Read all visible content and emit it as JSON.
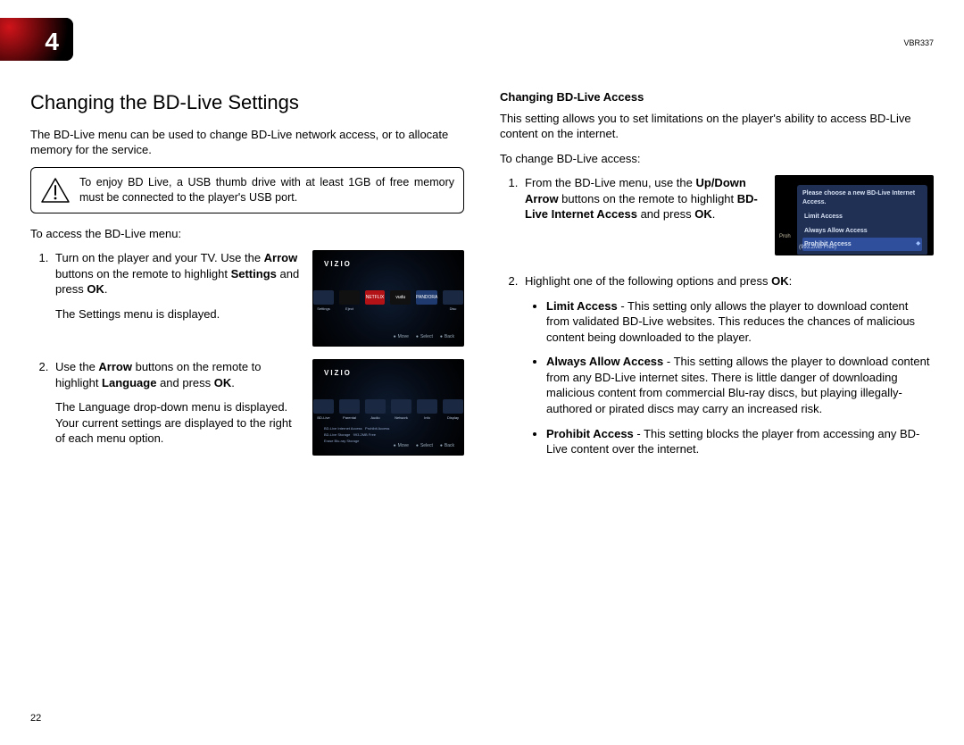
{
  "meta": {
    "model": "VBR337",
    "page_number": "22",
    "chapter": "4"
  },
  "left": {
    "heading": "Changing the BD-Live Settings",
    "intro": "The BD-Live menu can be used to change BD-Live network access, or to allocate memory for the service.",
    "callout": "To enjoy BD Live, a USB thumb drive with at least 1GB of free memory must be connected to the player's USB port.",
    "access_lead": "To access the BD-Live menu:",
    "step1a": "Turn on the player and your TV. Use the ",
    "step1b": "Arrow",
    "step1c": " buttons on the remote to highlight ",
    "step1d": "Settings",
    "step1e": " and press ",
    "step1f": "OK",
    "step1g": ".",
    "step1h": "The Settings menu is displayed.",
    "step2a": "Use the ",
    "step2b": "Arrow",
    "step2c": " buttons on the remote to highlight ",
    "step2d": "Language",
    "step2e": " and press ",
    "step2f": "OK",
    "step2g": ".",
    "step2h": "The Language drop-down menu is displayed. Your current settings are displayed to the right of each menu option.",
    "shot_logo": "VIZIO",
    "shot1_apps": [
      "",
      "",
      "NETFLIX",
      "vudu",
      "PANDORA",
      ""
    ],
    "shot1_labels": [
      "Settings",
      "Eject",
      "",
      "",
      "",
      "Disc"
    ],
    "shot2_row": [
      "BD-Live",
      "Parental",
      "Audio",
      "Network",
      "Info",
      "Display"
    ],
    "shot_footer": [
      "Move",
      "Select",
      "Back"
    ]
  },
  "right": {
    "subhead": "Changing BD-Live Access",
    "intro": "This setting allows you to set limitations on the player's ability to access BD-Live content on the internet.",
    "change_lead": "To change BD-Live access:",
    "step1a": "From the BD-Live menu, use the ",
    "step1b": "Up/Down Arrow",
    "step1c": " buttons on the remote to highlight ",
    "step1d": "BD-Live Internet Access",
    "step1e": " and press ",
    "step1f": "OK",
    "step1g": ".",
    "step2a": "Highlight one of the following options and press ",
    "step2b": "OK",
    "step2c": ":",
    "popup": {
      "title": "Please choose a new BD-Live Internet Access.",
      "opts": [
        "Limit Access",
        "Always Allow Access",
        "Prohibit Access"
      ],
      "left_label": "Proh",
      "free": "(993.2MB Free)"
    },
    "opts": {
      "limit_h": "Limit Access",
      "limit_t": " - This setting only allows the player to download content from validated BD-Live websites. This reduces the chances of malicious content being downloaded to the player.",
      "always_h": "Always Allow Access",
      "always_t": " - This setting allows the player to download content from any BD-Live internet sites. There is little danger of downloading malicious content from commercial Blu-ray discs, but playing illegally-authored or pirated discs may carry an increased risk.",
      "proh_h": "Prohibit Access",
      "proh_t": " - This setting blocks the player from accessing any BD-Live content over the internet."
    }
  }
}
